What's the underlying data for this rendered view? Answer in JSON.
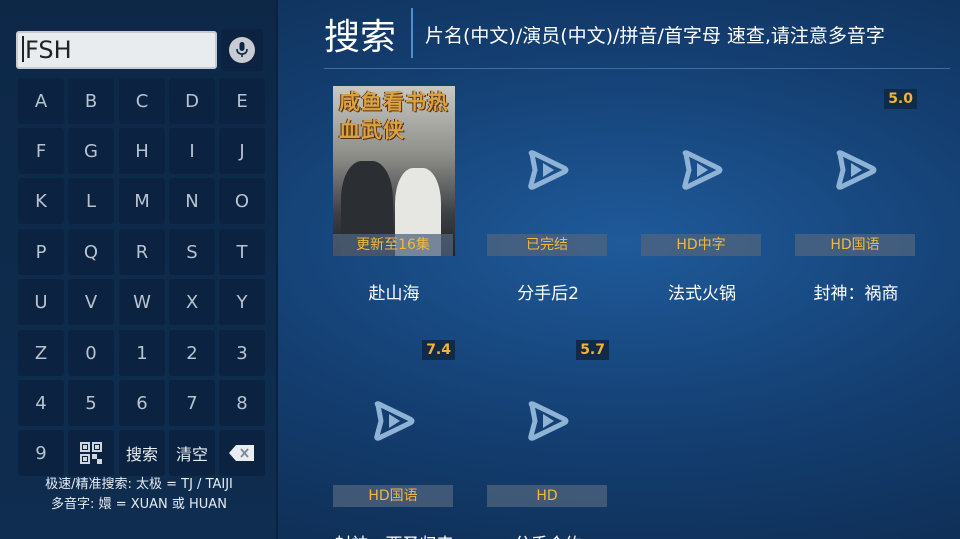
{
  "search": {
    "value": "FSH"
  },
  "keyboard": {
    "letters": [
      "A",
      "B",
      "C",
      "D",
      "E",
      "F",
      "G",
      "H",
      "I",
      "J",
      "K",
      "L",
      "M",
      "N",
      "O",
      "P",
      "Q",
      "R",
      "S",
      "T",
      "U",
      "V",
      "W",
      "X",
      "Y",
      "Z",
      "0",
      "1",
      "2",
      "3",
      "4",
      "5",
      "6",
      "7",
      "8"
    ],
    "last_row": {
      "nine": "9",
      "search": "搜索",
      "clear": "清空"
    }
  },
  "tips": {
    "line1": "极速/精准搜索: 太极 = TJ / TAIJI",
    "line2": "多音字: 嬛 = XUAN 或 HUAN"
  },
  "header": {
    "title": "搜索",
    "hint": "片名(中文)/演员(中文)/拼音/首字母 速查,请注意多音字"
  },
  "results": [
    {
      "title": "赴山海",
      "badge": "更新至16集",
      "score": "",
      "has_cover": true,
      "cover_text": "咸鱼看书热血武侠"
    },
    {
      "title": "分手后2",
      "badge": "已完结",
      "score": "",
      "has_cover": false
    },
    {
      "title": "法式火锅",
      "badge": "HD中字",
      "score": "",
      "has_cover": false
    },
    {
      "title": "封神：祸商",
      "badge": "HD国语",
      "score": "5.0",
      "has_cover": false
    },
    {
      "title": "封神：西圣归来",
      "badge": "HD国语",
      "score": "7.4",
      "has_cover": false
    },
    {
      "title": "分手合约",
      "badge": "HD",
      "score": "5.7",
      "has_cover": false
    }
  ],
  "colors": {
    "accent": "#f4b337",
    "badge_text": "#f3b83d",
    "key_bg": "#0b2340"
  },
  "icons": {
    "mic": "microphone-icon",
    "qr": "qr-code-icon",
    "backspace": "backspace-icon",
    "play": "play-icon"
  }
}
